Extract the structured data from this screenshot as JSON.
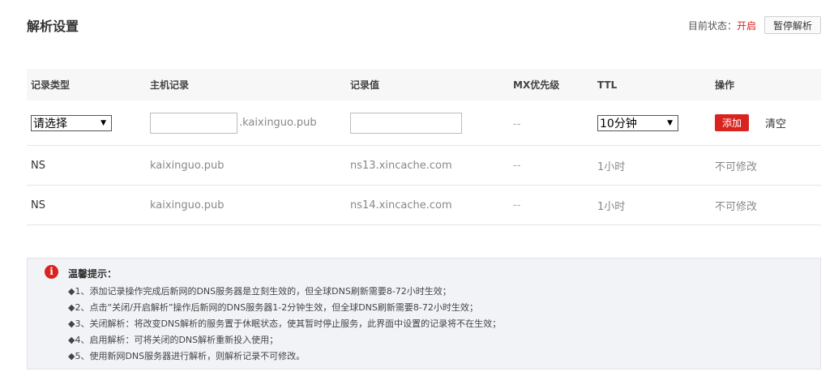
{
  "header": {
    "title": "解析设置",
    "status_label": "目前状态：",
    "status_value": "开启",
    "pause_button": "暂停解析"
  },
  "table": {
    "columns": [
      "记录类型",
      "主机记录",
      "记录值",
      "MX优先级",
      "TTL",
      "操作"
    ],
    "input_row": {
      "type_select": "请选择",
      "host_value": "",
      "domain_suffix": ".kaixinguo.pub",
      "value_value": "",
      "mx": "--",
      "ttl_select": "10分钟",
      "add_button": "添加",
      "clear_link": "清空"
    },
    "rows": [
      {
        "type": "NS",
        "host": "kaixinguo.pub",
        "value": "ns13.xincache.com",
        "mx": "--",
        "ttl": "1小时",
        "action": "不可修改"
      },
      {
        "type": "NS",
        "host": "kaixinguo.pub",
        "value": "ns14.xincache.com",
        "mx": "--",
        "ttl": "1小时",
        "action": "不可修改"
      }
    ]
  },
  "notice": {
    "icon": "info-icon",
    "icon_glyph": "i",
    "title": "温馨提示：",
    "items": [
      "◆1、添加记录操作完成后新网的DNS服务器是立刻生效的，但全球DNS刷新需要8-72小时生效；",
      "◆2、点击“关闭/开启解析”操作后新网的DNS服务器1-2分钟生效，但全球DNS刷新需要8-72小时生效；",
      "◆3、关闭解析：将改变DNS解析的服务置于休眠状态，使其暂时停止服务，此界面中设置的记录将不在生效；",
      "◆4、启用解析：可将关闭的DNS解析重新投入使用；",
      "◆5、使用新网DNS服务器进行解析，则解析记录不可修改。"
    ]
  },
  "colors": {
    "accent_red": "#d8231e",
    "header_bg": "#f7f7f7",
    "notice_bg": "#f1f3f6"
  }
}
